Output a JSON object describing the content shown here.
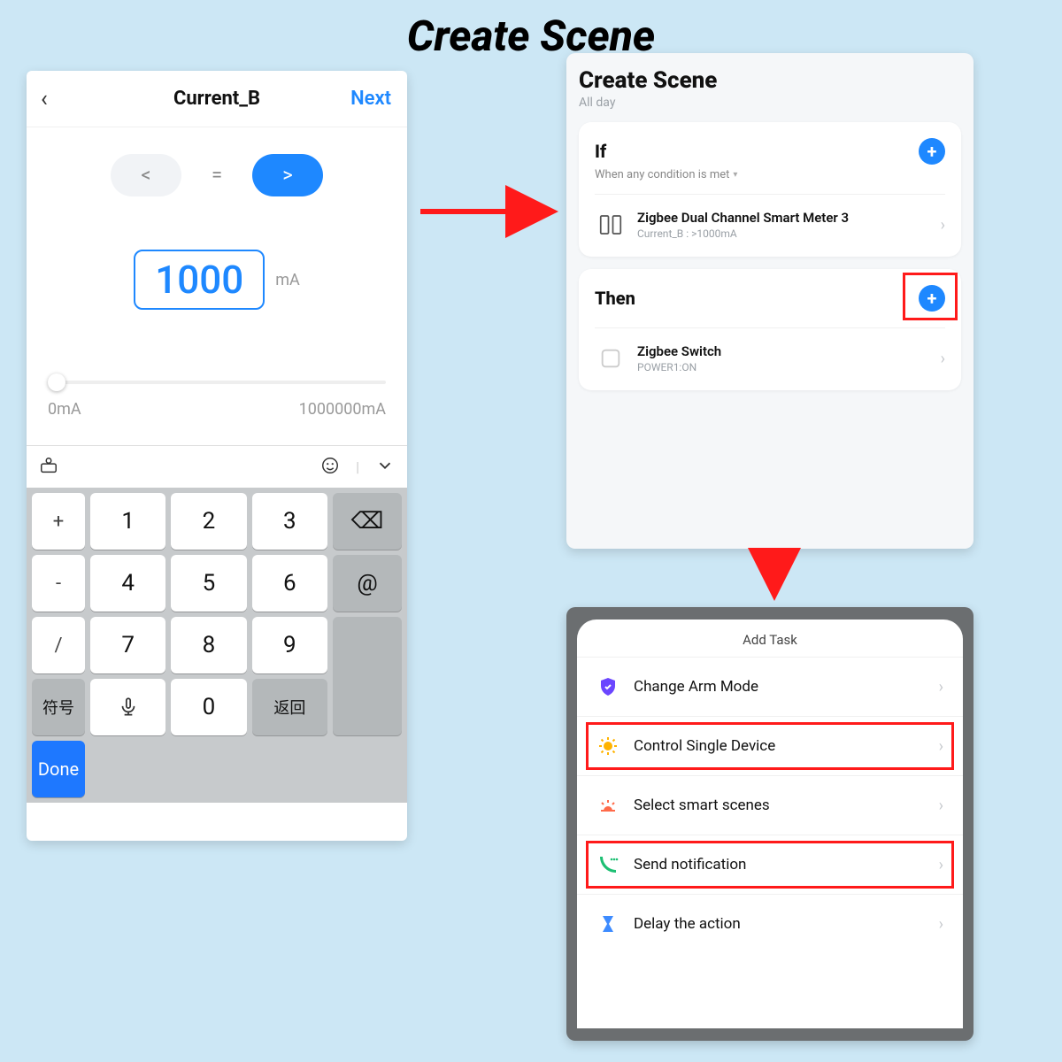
{
  "page_title": "Create Scene",
  "left": {
    "header_title": "Current_B",
    "next": "Next",
    "ops": {
      "lt": "<",
      "eq": "=",
      "gt": ">"
    },
    "value": "1000",
    "unit": "mA",
    "slider_min": "0mA",
    "slider_max": "1000000mA",
    "keys": {
      "side1": "+",
      "k1": "1",
      "k2": "2",
      "k3": "3",
      "bksp": "⌫",
      "side2": "-",
      "k4": "4",
      "k5": "5",
      "k6": "6",
      "at": "@",
      "side3": "/",
      "k7": "7",
      "k8": "8",
      "k9": "9",
      "sym": "符号",
      "mic": "⌄",
      "k0": "0",
      "ret": "返回",
      "done": "Done"
    }
  },
  "tr": {
    "title": "Create Scene",
    "subtitle": "All day",
    "if_label": "If",
    "if_sub": "When any condition is met",
    "if_dev_name": "Zigbee Dual Channel Smart Meter 3",
    "if_dev_desc": "Current_B : >1000mA",
    "then_label": "Then",
    "then_dev_name": "Zigbee Switch",
    "then_dev_desc": "POWER1:ON"
  },
  "br": {
    "title": "Add Task",
    "tasks": [
      "Change Arm Mode",
      "Control Single Device",
      "Select smart scenes",
      "Send notification",
      "Delay the action"
    ]
  }
}
